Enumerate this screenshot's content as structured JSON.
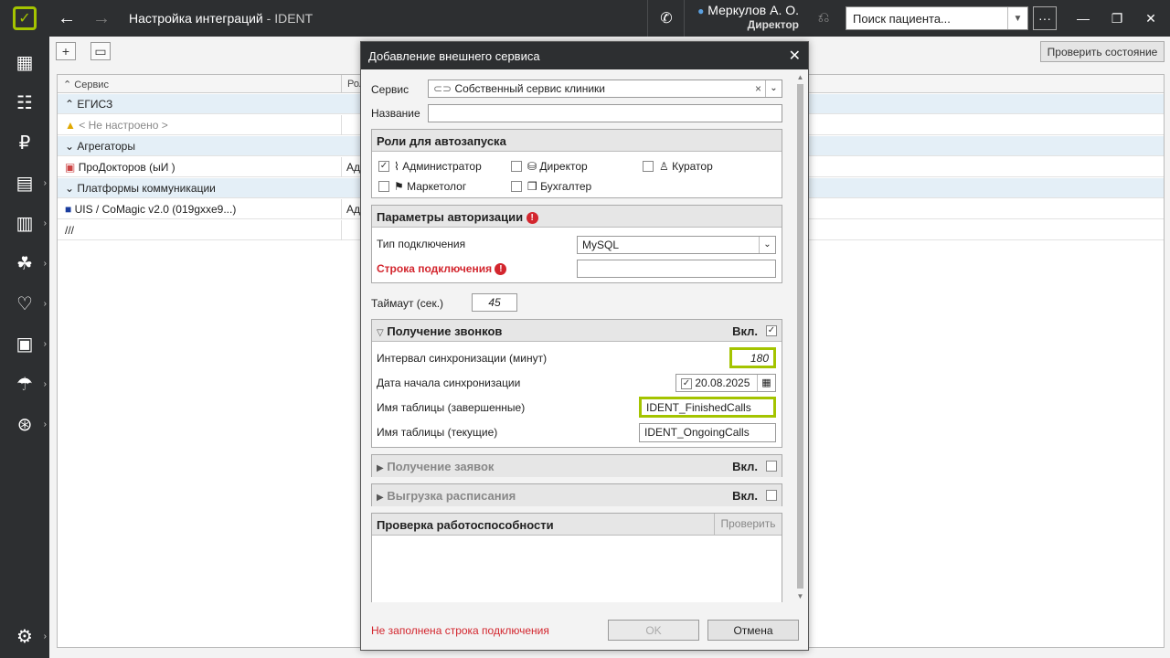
{
  "titlebar": {
    "title": "Настройка интеграций",
    "subtitle": " - IDENT",
    "user_name": "Меркулов А. О.",
    "user_role": "Директор",
    "search_placeholder": "Поиск пациента...",
    "more_label": "···"
  },
  "toolbar": {
    "check_state_label": "Проверить состояние"
  },
  "grid": {
    "columns": [
      "Сервис",
      "Рол"
    ],
    "rows": [
      {
        "type": "group",
        "text": "ЕГИСЗ"
      },
      {
        "type": "item",
        "text": "< Не настроено >",
        "role": ""
      },
      {
        "type": "group",
        "text": "Агрегаторы"
      },
      {
        "type": "item",
        "text": "ПроДокторов (ыИ )",
        "role": "Ад"
      },
      {
        "type": "group",
        "text": "Платформы коммуникации"
      },
      {
        "type": "item",
        "text": "UIS / CoMagic v2.0 (019gxxe9...)",
        "role": "Ад"
      },
      {
        "type": "item",
        "text": "///",
        "role": ""
      }
    ]
  },
  "dialog": {
    "title": "Добавление внешнего сервиса",
    "service_label": "Сервис",
    "service_value": "Собственный сервис клиники",
    "name_label": "Название",
    "name_value": "",
    "roles": {
      "title": "Роли для автозапуска",
      "items": [
        {
          "label": "Администратор",
          "checked": true
        },
        {
          "label": "Директор",
          "checked": false
        },
        {
          "label": "Куратор",
          "checked": false
        },
        {
          "label": "Маркетолог",
          "checked": false
        },
        {
          "label": "Бухгалтер",
          "checked": false
        }
      ]
    },
    "auth": {
      "title": "Параметры авторизации",
      "conn_type_label": "Тип подключения",
      "conn_type_value": "MySQL",
      "conn_string_label": "Строка подключения",
      "conn_string_value": ""
    },
    "timeout_label": "Таймаут (сек.)",
    "timeout_value": "45",
    "calls": {
      "title": "Получение звонков",
      "on_label": "Вкл.",
      "interval_label": "Интервал синхронизации (минут)",
      "interval_value": "180",
      "start_label": "Дата начала синхронизации",
      "start_value": "20.08.2025",
      "finished_label": "Имя таблицы (завершенные)",
      "finished_value": "IDENT_FinishedCalls",
      "ongoing_label": "Имя таблицы (текущие)",
      "ongoing_value": "IDENT_OngoingCalls"
    },
    "requests": {
      "title": "Получение заявок",
      "on_label": "Вкл."
    },
    "schedule": {
      "title": "Выгрузка расписания",
      "on_label": "Вкл."
    },
    "health": {
      "title": "Проверка работоспособности",
      "check_label": "Проверить"
    },
    "error_text": "Не заполнена строка подключения",
    "ok_label": "OK",
    "cancel_label": "Отмена"
  },
  "colors": {
    "accent": "#a4c400",
    "error": "#d3262e",
    "dark": "#2d2f31"
  }
}
